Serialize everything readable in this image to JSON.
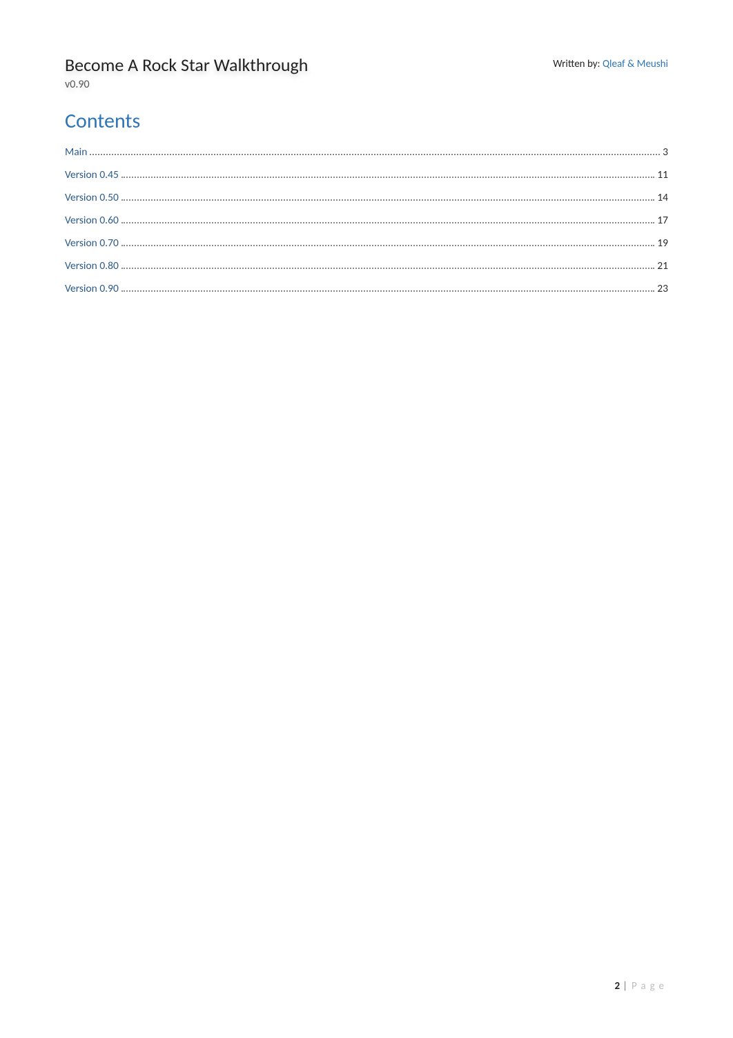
{
  "header": {
    "title": "Become A Rock Star Walkthrough",
    "version": "v0.90",
    "written_by_label": "Written by: ",
    "authors": "Qleaf & Meushi"
  },
  "contents_heading": "Contents",
  "toc": [
    {
      "label": "Main",
      "page": "3"
    },
    {
      "label": "Version 0.45",
      "page": "11"
    },
    {
      "label": "Version 0.50",
      "page": "14"
    },
    {
      "label": "Version 0.60",
      "page": "17"
    },
    {
      "label": "Version 0.70",
      "page": "19"
    },
    {
      "label": "Version 0.80",
      "page": "21"
    },
    {
      "label": "Version 0.90",
      "page": "23"
    }
  ],
  "footer": {
    "page_number": "2",
    "bar": "|",
    "page_word": "Page"
  }
}
